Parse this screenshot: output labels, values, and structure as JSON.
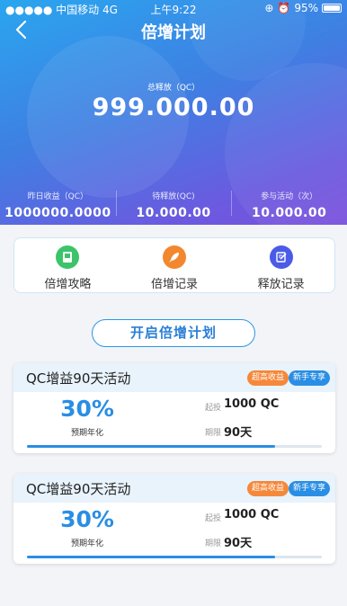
{
  "status_bar": {
    "carrier": "●●●●● 中国移动  4G",
    "time": "上午9:22",
    "battery": "95%"
  },
  "nav": {
    "title": "倍增计划"
  },
  "summary": {
    "total_label": "总释放（QC）",
    "total_value": "999.000.00",
    "stats": [
      {
        "label": "昨日收益（QC）",
        "value": "1000000.0000"
      },
      {
        "label": "待释放(QC)",
        "value": "10.000.00"
      },
      {
        "label": "参与活动（次）",
        "value": "10.000.00"
      }
    ]
  },
  "quick_links": [
    {
      "label": "倍增攻略",
      "icon": "book-icon",
      "color": "#3cc46a"
    },
    {
      "label": "倍增记录",
      "icon": "rocket-icon",
      "color": "#f2872e"
    },
    {
      "label": "释放记录",
      "icon": "edit-icon",
      "color": "#4a5be8"
    }
  ],
  "cta": {
    "label": "开启倍增计划"
  },
  "plans": [
    {
      "title": "QC增益90天活动",
      "tags": [
        "超高收益",
        "新手专享"
      ],
      "rate": "30%",
      "rate_label": "预期年化",
      "min_label": "起投",
      "min_value": "1000 QC",
      "period_label": "期限",
      "period_value": "90天",
      "progress": 0.84
    },
    {
      "title": "QC增益90天活动",
      "tags": [
        "超高收益",
        "新手专享"
      ],
      "rate": "30%",
      "rate_label": "预期年化",
      "min_label": "起投",
      "min_value": "1000 QC",
      "period_label": "期限",
      "period_value": "90天",
      "progress": 0.84
    }
  ],
  "colors": {
    "accent": "#2a8ee4",
    "orange": "#f5883a",
    "card_header": "#e8f3fc"
  }
}
